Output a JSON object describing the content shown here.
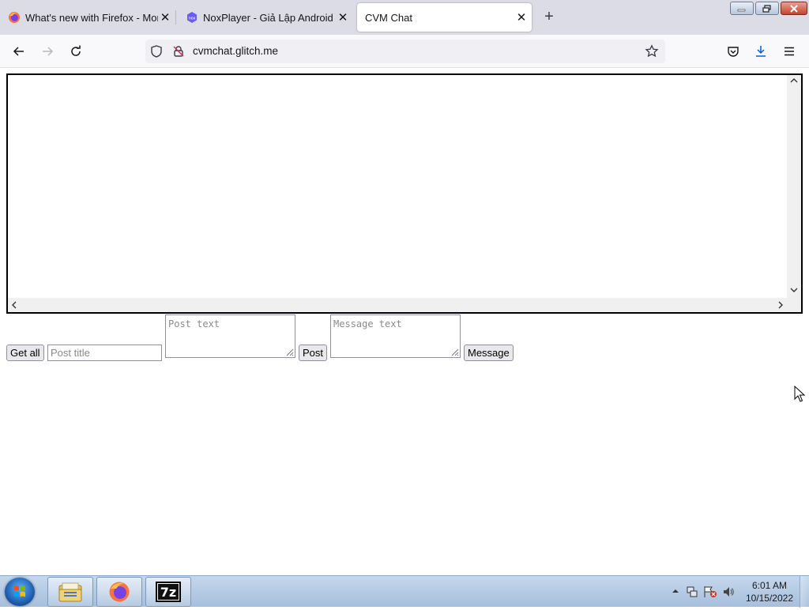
{
  "window": {
    "controls": [
      "minimize-button",
      "restore-button",
      "close-button"
    ]
  },
  "tabs": [
    {
      "title": "What's new with Firefox - More",
      "icon": "firefox-icon",
      "active": false
    },
    {
      "title": "NoxPlayer - Giả Lập Android Nh",
      "icon": "nox-icon",
      "active": false
    },
    {
      "title": "CVM Chat",
      "icon": "",
      "active": true
    }
  ],
  "navbar": {
    "url": "cvmchat.glitch.me"
  },
  "page": {
    "get_all_label": "Get all",
    "post_title_placeholder": "Post title",
    "post_text_placeholder": "Post text",
    "post_label": "Post",
    "message_text_placeholder": "Message text",
    "message_label": "Message"
  },
  "taskbar": {
    "items": [
      "windows-explorer-icon",
      "firefox-icon",
      "7zip-icon"
    ],
    "time": "6:01 AM",
    "date": "10/15/2022"
  },
  "colors": {
    "tab_strip": "#dcdce6",
    "nav_bar": "#f9f9fb",
    "taskbar": "#b4c9e3"
  }
}
